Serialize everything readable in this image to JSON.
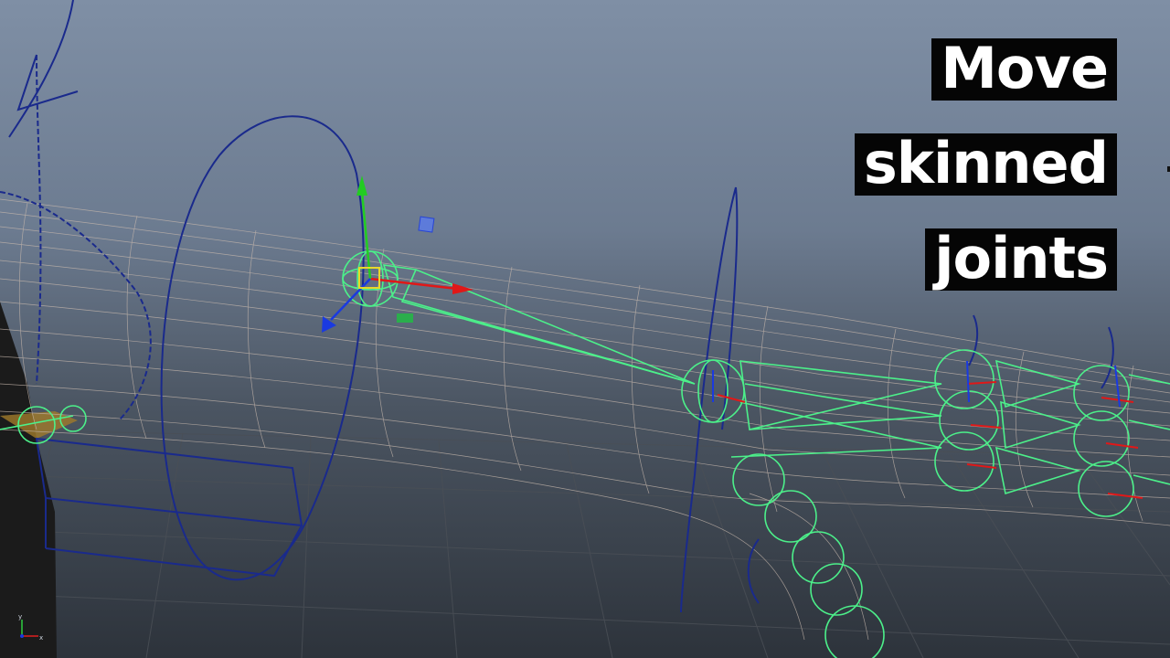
{
  "overlay": {
    "lines": [
      "Move",
      "skinned",
      "joints"
    ]
  },
  "viewport": {
    "background_top": "#7f8fa5",
    "background_bottom": "#2d333b",
    "grid_color": "#4a4f56",
    "mesh_color": "#c7b8ad",
    "joint_color": "#4cf08a",
    "control_curve_color": "#1a2a8c"
  },
  "manipulator": {
    "x_axis_color": "#e01818",
    "y_axis_color": "#22cc22",
    "z_axis_color": "#1a3ae0",
    "pivot_color": "#e8d82a"
  },
  "axis_indicator": {
    "labels": [
      "y",
      "x"
    ]
  }
}
